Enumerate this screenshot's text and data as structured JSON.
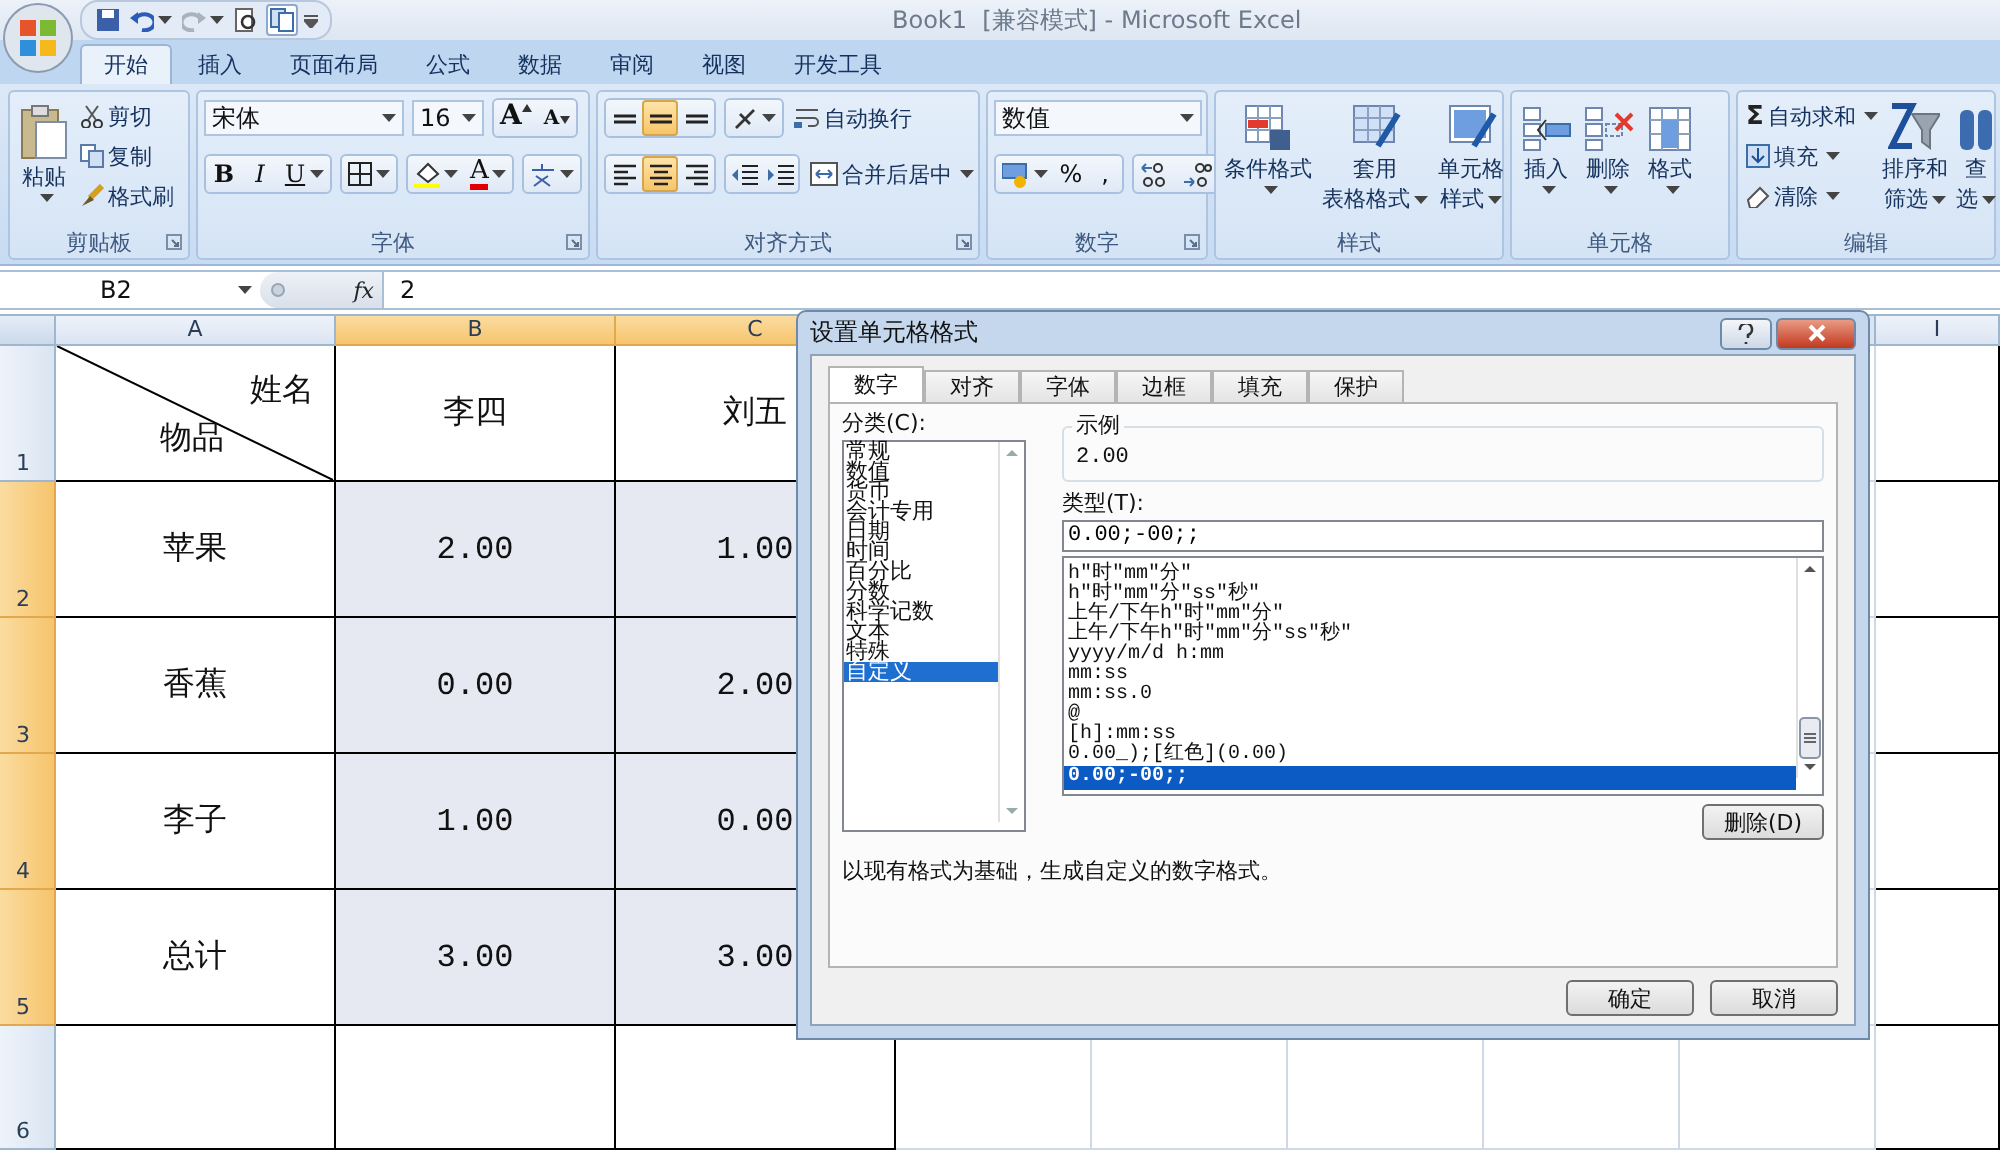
{
  "window": {
    "title": "Book1  [兼容模式] - Microsoft Excel"
  },
  "ribbon_tabs": [
    {
      "label": "开始",
      "selected": true
    },
    {
      "label": "插入",
      "selected": false
    },
    {
      "label": "页面布局",
      "selected": false
    },
    {
      "label": "公式",
      "selected": false
    },
    {
      "label": "数据",
      "selected": false
    },
    {
      "label": "审阅",
      "selected": false
    },
    {
      "label": "视图",
      "selected": false
    },
    {
      "label": "开发工具",
      "selected": false
    }
  ],
  "ribbon_groups": [
    {
      "kind": "clipboard",
      "label": "剪贴板",
      "paste": "粘贴",
      "items": [
        "剪切",
        "复制",
        "格式刷"
      ]
    },
    {
      "kind": "font",
      "label": "字体",
      "font": "宋体",
      "size": "16",
      "grow": "A",
      "shrink": "A",
      "styles": [
        "B",
        "I",
        "U"
      ],
      "font_color": "A"
    },
    {
      "kind": "align",
      "label": "对齐方式",
      "vertical": [
        {
          "selected": false
        },
        {
          "selected": true
        },
        {
          "selected": false
        }
      ],
      "horizontal": [
        {
          "selected": false
        },
        {
          "selected": true
        },
        {
          "selected": false
        }
      ],
      "wrap": "自动换行",
      "merge": "合并后居中"
    },
    {
      "kind": "number",
      "label": "数字",
      "format": "数值",
      "symbols": [
        "%",
        ","
      ]
    },
    {
      "kind": "large",
      "label": "样式",
      "buttons": [
        {
          "lines": [
            "条件格式"
          ]
        },
        {
          "lines": [
            "套用",
            "表格格式"
          ]
        },
        {
          "lines": [
            "单元格",
            "样式"
          ]
        }
      ]
    },
    {
      "kind": "large",
      "label": "单元格",
      "buttons": [
        {
          "lines": [
            "插入"
          ]
        },
        {
          "lines": [
            "删除"
          ]
        },
        {
          "lines": [
            "格式"
          ]
        }
      ]
    },
    {
      "kind": "editing",
      "label": "编辑",
      "sum_symbol": "Σ",
      "items": [
        "自动求和",
        "填充",
        "清除"
      ],
      "buttons": [
        {
          "lines": [
            "排序和",
            "筛选"
          ]
        },
        {
          "lines": [
            "查",
            "选"
          ]
        }
      ]
    }
  ],
  "formula_bar": {
    "name_box": "B2",
    "fx": "fx",
    "value": "2"
  },
  "sheet": {
    "columns": [
      {
        "label": "A",
        "selected": false
      },
      {
        "label": "B",
        "selected": true
      },
      {
        "label": "C",
        "selected": true
      },
      {
        "label": "I",
        "selected": false
      }
    ],
    "rows": [
      {
        "label": "1",
        "selected": false,
        "cells": [
          {
            "kind": "diagonal",
            "top": "姓名",
            "bottom": "物品",
            "selected": false
          },
          {
            "kind": "text",
            "text": "李四",
            "selected": false
          },
          {
            "kind": "text",
            "text": "刘五",
            "selected": false
          }
        ]
      },
      {
        "label": "2",
        "selected": true,
        "cells": [
          {
            "kind": "text",
            "text": "苹果",
            "selected": false
          },
          {
            "kind": "number",
            "text": "2.00",
            "selected": true
          },
          {
            "kind": "number",
            "text": "1.00",
            "selected": true
          }
        ]
      },
      {
        "label": "3",
        "selected": true,
        "cells": [
          {
            "kind": "text",
            "text": "香蕉",
            "selected": false
          },
          {
            "kind": "number",
            "text": "0.00",
            "selected": true
          },
          {
            "kind": "number",
            "text": "2.00",
            "selected": true
          }
        ]
      },
      {
        "label": "4",
        "selected": true,
        "cells": [
          {
            "kind": "text",
            "text": "李子",
            "selected": false
          },
          {
            "kind": "number",
            "text": "1.00",
            "selected": true
          },
          {
            "kind": "number",
            "text": "0.00",
            "selected": true
          }
        ]
      },
      {
        "label": "5",
        "selected": true,
        "cells": [
          {
            "kind": "text",
            "text": "总计",
            "selected": false
          },
          {
            "kind": "number",
            "text": "3.00",
            "selected": true
          },
          {
            "kind": "number",
            "text": "3.00",
            "selected": true
          }
        ]
      },
      {
        "label": "6",
        "selected": false
      }
    ]
  },
  "dialog": {
    "title": "设置单元格格式",
    "tabs": [
      {
        "label": "数字",
        "selected": true
      },
      {
        "label": "对齐",
        "selected": false
      },
      {
        "label": "字体",
        "selected": false
      },
      {
        "label": "边框",
        "selected": false
      },
      {
        "label": "填充",
        "selected": false
      },
      {
        "label": "保护",
        "selected": false
      }
    ],
    "category_label": "分类(C):",
    "categories": [
      {
        "label": "常规",
        "selected": false
      },
      {
        "label": "数值",
        "selected": false
      },
      {
        "label": "货币",
        "selected": false
      },
      {
        "label": "会计专用",
        "selected": false
      },
      {
        "label": "日期",
        "selected": false
      },
      {
        "label": "时间",
        "selected": false
      },
      {
        "label": "百分比",
        "selected": false
      },
      {
        "label": "分数",
        "selected": false
      },
      {
        "label": "科学记数",
        "selected": false
      },
      {
        "label": "文本",
        "selected": false
      },
      {
        "label": "特殊",
        "selected": false
      },
      {
        "label": "自定义",
        "selected": true
      }
    ],
    "sample_label": "示例",
    "sample": "2.00",
    "type_label": "类型(T):",
    "type_value": "0.00;-00;;",
    "types": [
      {
        "label": "h\"时\"mm\"分\"",
        "selected": false
      },
      {
        "label": "h\"时\"mm\"分\"ss\"秒\"",
        "selected": false
      },
      {
        "label": "上午/下午h\"时\"mm\"分\"",
        "selected": false
      },
      {
        "label": "上午/下午h\"时\"mm\"分\"ss\"秒\"",
        "selected": false
      },
      {
        "label": "yyyy/m/d h:mm",
        "selected": false
      },
      {
        "label": "mm:ss",
        "selected": false
      },
      {
        "label": "mm:ss.0",
        "selected": false
      },
      {
        "label": "@",
        "selected": false
      },
      {
        "label": "[h]:mm:ss",
        "selected": false
      },
      {
        "label": "0.00_);[红色](0.00)",
        "selected": false
      },
      {
        "label": "0.00;-00;;",
        "selected": true
      }
    ],
    "delete_button": "删除(D)",
    "description": "以现有格式为基础，生成自定义的数字格式。",
    "buttons": [
      "确定",
      "取消"
    ]
  }
}
